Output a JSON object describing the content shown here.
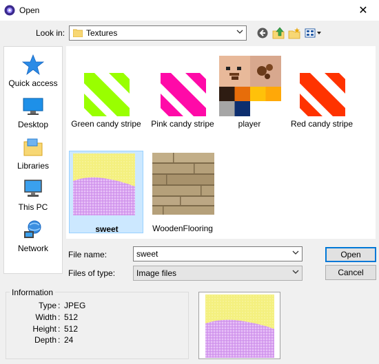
{
  "window": {
    "title": "Open",
    "close_glyph": "✕"
  },
  "toolbar": {
    "look_in_label": "Look in:",
    "look_in_value": "Textures"
  },
  "places": [
    {
      "label": "Quick access",
      "icon": "star-icon"
    },
    {
      "label": "Desktop",
      "icon": "desktop-icon"
    },
    {
      "label": "Libraries",
      "icon": "libraries-icon"
    },
    {
      "label": "This PC",
      "icon": "computer-icon"
    },
    {
      "label": "Network",
      "icon": "network-icon"
    }
  ],
  "files": [
    {
      "name": "Green candy stripe",
      "color": "#99ff00",
      "kind": "stripe"
    },
    {
      "name": "Pink candy stripe",
      "color": "#ff0aa8",
      "kind": "stripe"
    },
    {
      "name": "player",
      "kind": "player"
    },
    {
      "name": "Red candy stripe",
      "color": "#ff3300",
      "kind": "stripe"
    },
    {
      "name": "sweet",
      "kind": "sweet",
      "selected": true
    },
    {
      "name": "WoodenFlooring",
      "kind": "wood"
    }
  ],
  "form": {
    "file_name_label": "File name:",
    "file_name_value": "sweet",
    "file_type_label": "Files of type:",
    "file_type_value": "Image files"
  },
  "buttons": {
    "open": "Open",
    "cancel": "Cancel"
  },
  "info": {
    "legend": "Information",
    "rows": [
      {
        "key": "Type",
        "value": "JPEG"
      },
      {
        "key": "Width",
        "value": "512"
      },
      {
        "key": "Height",
        "value": "512"
      },
      {
        "key": "Depth",
        "value": "24"
      }
    ]
  }
}
